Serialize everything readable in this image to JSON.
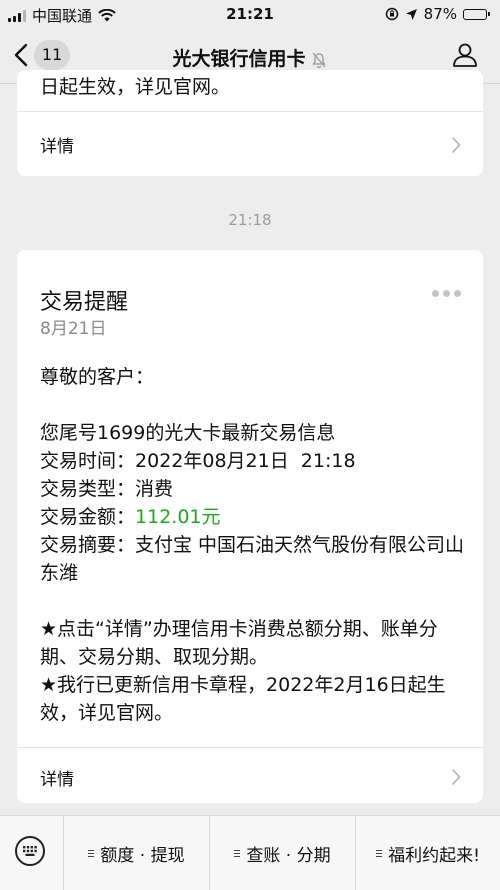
{
  "status_bar": {
    "carrier": "中国联通",
    "time": "21:21",
    "battery_percent": "87%",
    "battery_level": 0.87
  },
  "nav": {
    "unread_count": "11",
    "title": "光大银行信用卡"
  },
  "prev_card": {
    "cut_text": "日起生效，详见官网。",
    "detail_label": "详情"
  },
  "timestamp": "21:18",
  "message": {
    "title": "交易提醒",
    "date": "8月21日",
    "greeting": "尊敬的客户：",
    "intro": "您尾号1699的光大卡最新交易信息",
    "time_label": "交易时间：",
    "time_value": "2022年08月21日  21:18",
    "type_label": "交易类型：",
    "type_value": "消费",
    "amount_label": "交易金额：",
    "amount_value": "112.01元",
    "summary_label": "交易摘要：",
    "summary_value": "支付宝 中国石油天然气股份有限公司山东潍",
    "note1": "★点击“详情”办理信用卡消费总额分期、账单分期、交易分期、取现分期。",
    "note2": "★我行已更新信用卡章程，2022年2月16日起生效，详见官网。",
    "detail_label": "详情",
    "amount_color": "#1aad19"
  },
  "bottom_menu": {
    "items": [
      {
        "label": "额度 · 提现"
      },
      {
        "label": "查账 · 分期"
      },
      {
        "label": "福利约起来!"
      }
    ]
  }
}
